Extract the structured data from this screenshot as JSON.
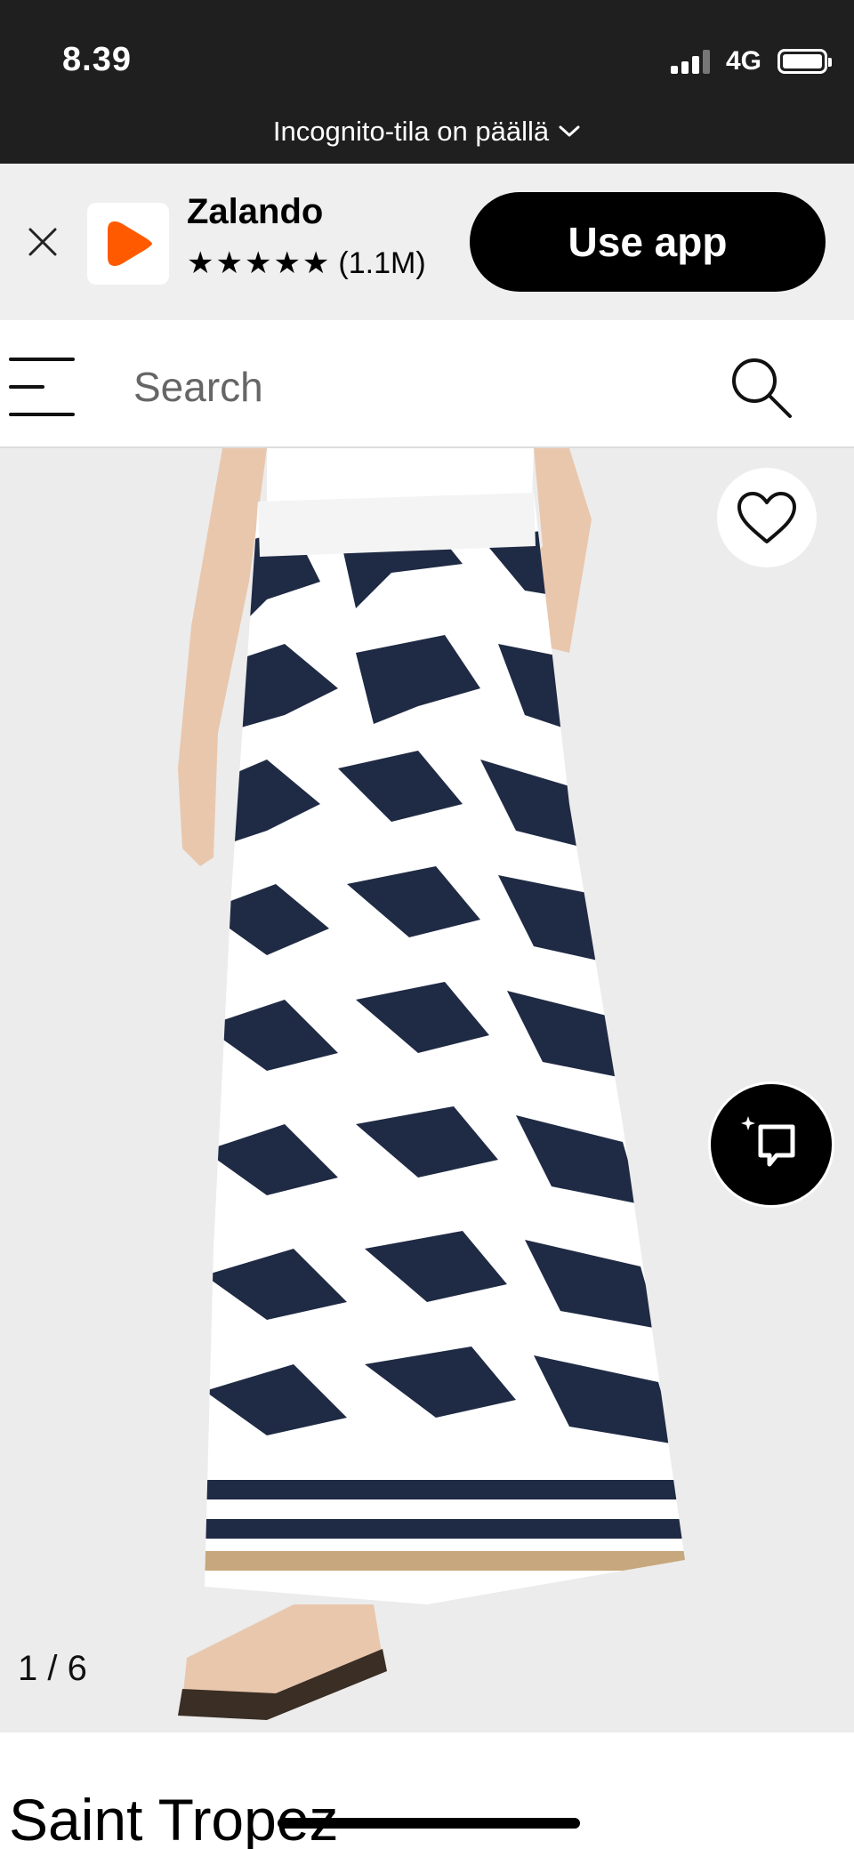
{
  "status_bar": {
    "time": "8.39",
    "network": "4G",
    "incognito_label": "Incognito-tila on päällä"
  },
  "app_banner": {
    "app_name": "Zalando",
    "stars": "★★★★★",
    "rating_count": "(1.1M)",
    "cta_label": "Use app",
    "brand_color": "#ff5a00"
  },
  "search": {
    "placeholder": "Search"
  },
  "gallery": {
    "counter": "1 / 6",
    "print_colors": [
      "#1f2a44",
      "#ffffff",
      "#c7a77d"
    ]
  },
  "product": {
    "brand": "Saint Tropez"
  },
  "icons": {
    "close": "close-icon",
    "menu": "menu-icon",
    "search": "search-icon",
    "wishlist": "heart-icon",
    "similar": "similar-items-icon"
  }
}
